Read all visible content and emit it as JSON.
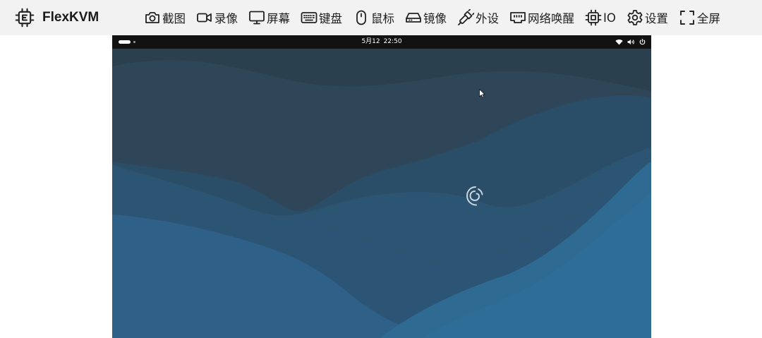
{
  "app": {
    "title": "FlexKVM",
    "logo_icon": "chip-logo-icon"
  },
  "toolbar": {
    "items": [
      {
        "id": "screenshot",
        "label": "截图",
        "icon": "camera-icon"
      },
      {
        "id": "record",
        "label": "录像",
        "icon": "video-camera-icon"
      },
      {
        "id": "display",
        "label": "屏幕",
        "icon": "monitor-icon"
      },
      {
        "id": "keyboard",
        "label": "键盘",
        "icon": "keyboard-icon"
      },
      {
        "id": "mouse",
        "label": "鼠标",
        "icon": "mouse-icon"
      },
      {
        "id": "mirror",
        "label": "镜像",
        "icon": "hard-drive-icon"
      },
      {
        "id": "peripherals",
        "label": "外设",
        "icon": "usb-plug-icon"
      },
      {
        "id": "wol",
        "label": "网络唤醒",
        "icon": "ethernet-port-icon"
      },
      {
        "id": "io",
        "label": "IO",
        "icon": "cpu-icon"
      },
      {
        "id": "settings",
        "label": "设置",
        "icon": "gear-icon"
      },
      {
        "id": "fullscreen",
        "label": "全屏",
        "icon": "fullscreen-icon"
      }
    ]
  },
  "remote_desktop": {
    "top_bar": {
      "date": "5月12",
      "time": "22:50",
      "status_icons": [
        "wifi-icon",
        "volume-icon",
        "power-icon"
      ]
    },
    "colors": {
      "top_bar": "#121212",
      "wallpaper_dark": "#2e4657",
      "wallpaper_mid": "#2c5573",
      "wallpaper_light": "#2e6a92"
    }
  }
}
